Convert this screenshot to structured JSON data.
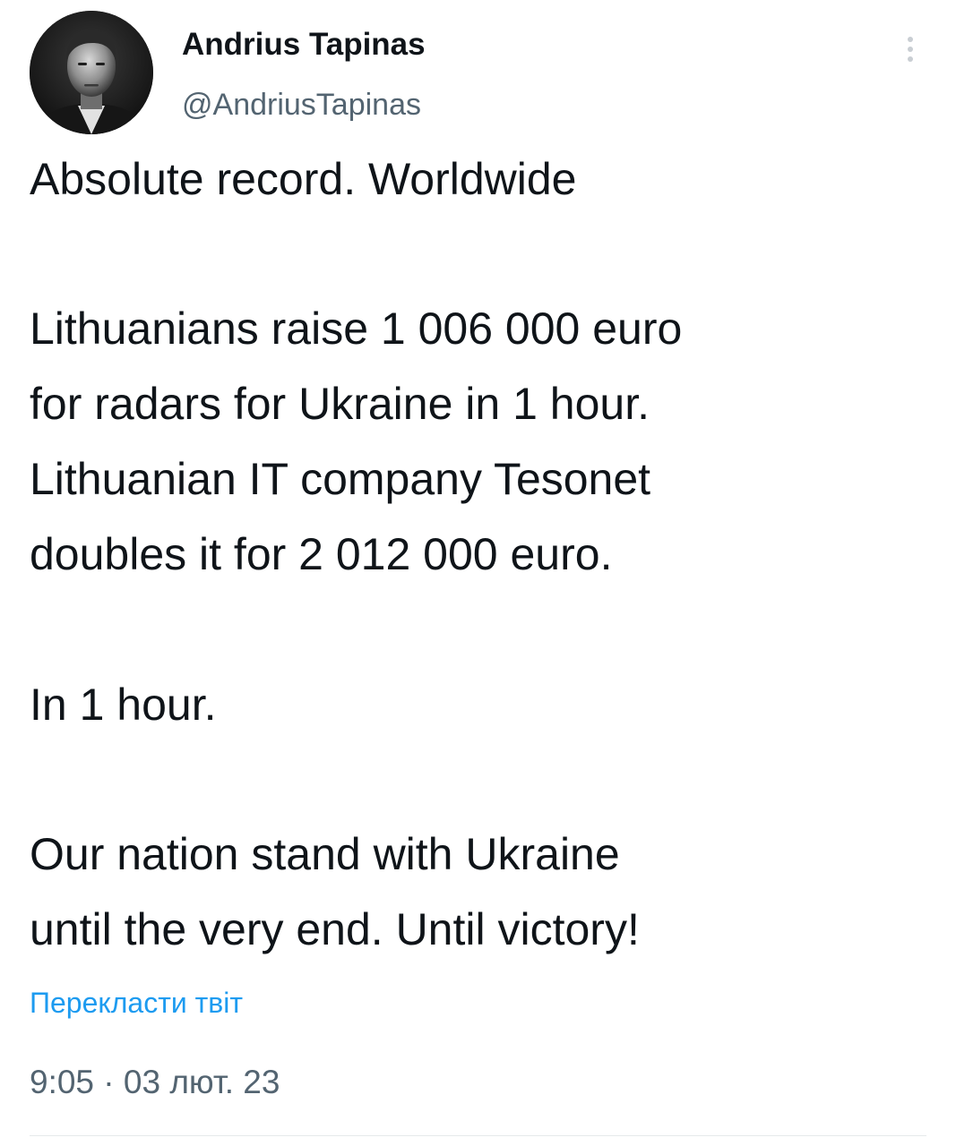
{
  "author": {
    "name": "Andrius Tapinas",
    "handle": "@AndriusTapinas"
  },
  "menu": {
    "icon": "more-vertical-icon"
  },
  "tweet": {
    "lines": [
      "Absolute record. Worldwide",
      "Lithuanians raise 1 006 000 euro",
      "for radars for Ukraine in 1 hour.",
      "Lithuanian IT company Tesonet",
      "doubles it for 2 012 000 euro.",
      "In 1 hour.",
      "Our nation stand with Ukraine",
      "until the very end. Until victory!"
    ]
  },
  "translate_label": "Перекласти твіт",
  "timestamp": "9:05 · 03 лют. 23",
  "colors": {
    "text": "#0f1419",
    "secondary": "#536471",
    "link": "#1d9bf0"
  }
}
